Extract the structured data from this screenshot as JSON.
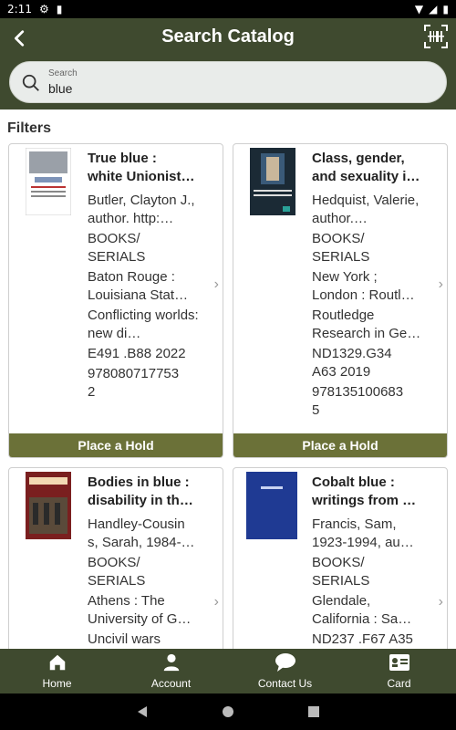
{
  "status_bar": {
    "time": "2:11"
  },
  "header": {
    "title": "Search Catalog",
    "back_icon": "back-arrow-icon",
    "barcode_icon": "barcode-scan-icon"
  },
  "search": {
    "label": "Search",
    "value": "blue"
  },
  "filters_label": "Filters",
  "results": [
    {
      "title": "True blue :\nwhite Unionist…",
      "author": "Butler, Clayton J., author. http:…",
      "format": "BOOKS/\nSERIALS",
      "publisher": "Baton Rouge :\nLouisiana Stat…",
      "series": "Conflicting worlds: new di…",
      "call_number": "E491 .B88 2022",
      "isbn": "978080717753\n2",
      "action": "Place a Hold"
    },
    {
      "title": "Class, gender,\nand sexuality i…",
      "author": "Hedquist, Valerie, author.…",
      "format": "BOOKS/\nSERIALS",
      "publisher": "New York ;\nLondon : Routl…",
      "series": "Routledge Research in Ge…",
      "call_number": "ND1329.G34\nA63 2019",
      "isbn": "978135100683\n5",
      "action": "Place a Hold"
    },
    {
      "title": "Bodies in blue :\ndisability in th…",
      "author": "Handley-Cousin\ns, Sarah, 1984-…",
      "format": "BOOKS/\nSERIALS",
      "publisher": "Athens : The\nUniversity of G…",
      "series": "Uncivil wars",
      "call_number": "",
      "isbn": "",
      "action": ""
    },
    {
      "title": "Cobalt blue :\nwritings from …",
      "author": "Francis, Sam,\n1923-1994, au…",
      "format": "BOOKS/\nSERIALS",
      "publisher": "Glendale,\nCalifornia : Sa…",
      "series": "ND237 .F67 A35",
      "call_number": "",
      "isbn": "",
      "action": ""
    }
  ],
  "bottom_nav": [
    {
      "label": "Home",
      "icon": "home-icon"
    },
    {
      "label": "Account",
      "icon": "account-icon"
    },
    {
      "label": "Contact Us",
      "icon": "chat-bubble-icon"
    },
    {
      "label": "Card",
      "icon": "library-card-icon"
    }
  ],
  "colors": {
    "header": "#3f4a2f",
    "hold_button": "#6b7138"
  }
}
